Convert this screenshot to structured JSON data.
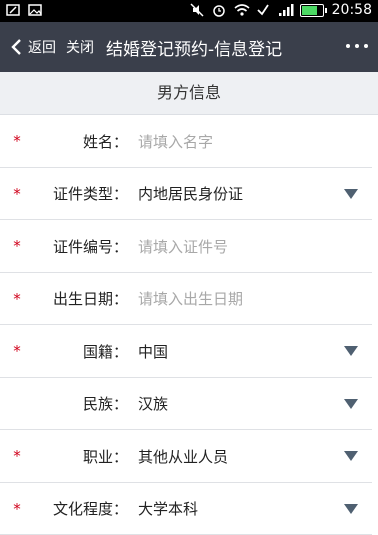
{
  "status_bar": {
    "time": "20:58"
  },
  "nav": {
    "back_label": "返回",
    "close_label": "关闭",
    "title": "结婚登记预约-信息登记"
  },
  "section": {
    "title": "男方信息"
  },
  "fields": [
    {
      "required": "*",
      "label": "姓名：",
      "value": "",
      "placeholder": "请填入名字"
    },
    {
      "required": "*",
      "label": "证件类型：",
      "value": "内地居民身份证"
    },
    {
      "required": "*",
      "label": "证件编号：",
      "value": "",
      "placeholder": "请填入证件号"
    },
    {
      "required": "*",
      "label": "出生日期：",
      "value": "",
      "placeholder": "请填入出生日期"
    },
    {
      "required": "*",
      "label": "国籍：",
      "value": "中国"
    },
    {
      "required": "",
      "label": "民族：",
      "value": "汉族"
    },
    {
      "required": "*",
      "label": "职业：",
      "value": "其他从业人员"
    },
    {
      "required": "*",
      "label": "文化程度：",
      "value": "大学本科"
    }
  ]
}
